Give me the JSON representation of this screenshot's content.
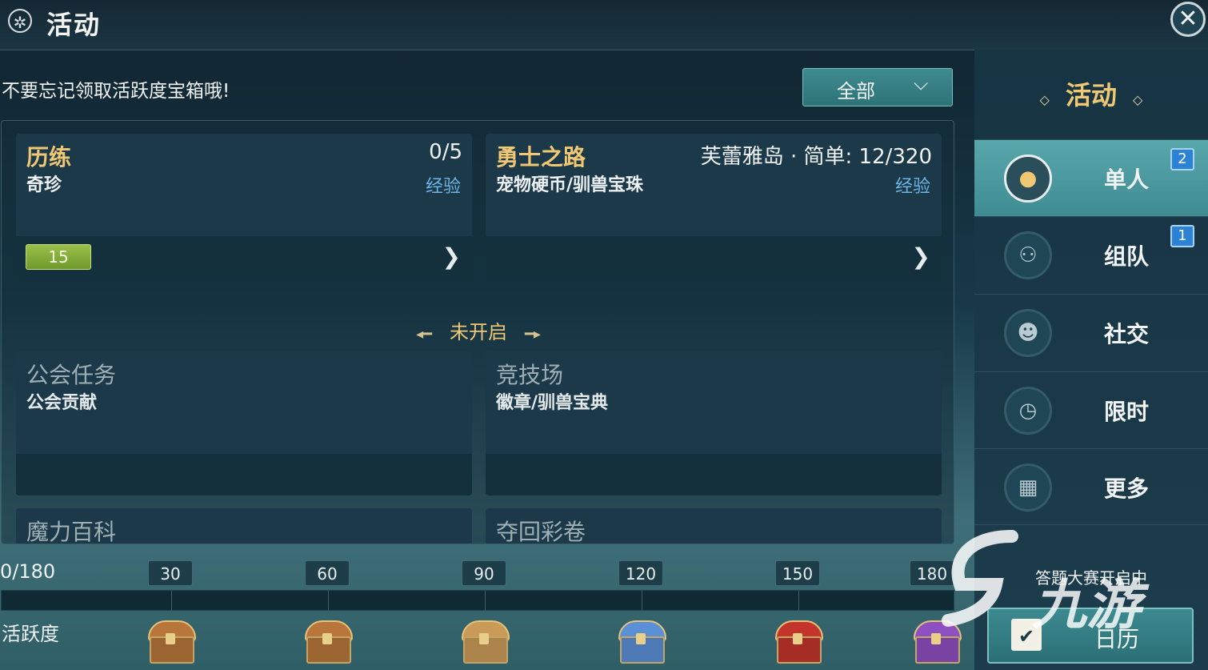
{
  "header": {
    "title": "活动",
    "title_icon": "wheel-icon",
    "close_icon": "close-icon"
  },
  "reminder": "不要忘记领取活跃度宝箱哦!",
  "filter": {
    "selected": "全部",
    "chevron": "⌄"
  },
  "cards": [
    {
      "title": "历练",
      "subtitle": "奇珍",
      "count": "0/5",
      "reward": "经验",
      "level": "15",
      "arrow": "›"
    },
    {
      "title": "勇士之路",
      "subtitle": "宠物硬币/驯兽宝珠",
      "count": "芙蕾雅岛 · 简单: 12/320",
      "reward": "经验",
      "arrow": "›"
    }
  ],
  "not_open_label": "未开启",
  "locked_cards": [
    {
      "title": "公会任务",
      "subtitle": "公会贡献"
    },
    {
      "title": "竞技场",
      "subtitle": "徽章/驯兽宝典"
    },
    {
      "title": "魔力百科"
    },
    {
      "title": "夺回彩卷"
    }
  ],
  "activity": {
    "progress_text": "0/180",
    "current": 0,
    "max": 180,
    "label": "活跃度",
    "milestones": [
      "30",
      "60",
      "90",
      "120",
      "150",
      "180"
    ],
    "chests": [
      {
        "name": "wooden-chest",
        "color": "#b8763a"
      },
      {
        "name": "wooden-chest",
        "color": "#b8763a"
      },
      {
        "name": "bronze-chest",
        "color": "#c99a58"
      },
      {
        "name": "silver-blue-chest",
        "color": "#5b8fd6"
      },
      {
        "name": "red-gold-chest",
        "color": "#c3352b"
      },
      {
        "name": "purple-gold-chest",
        "color": "#8e4fc0"
      }
    ]
  },
  "sidebar": {
    "heading": "活动",
    "items": [
      {
        "label": "单人",
        "icon": "person-icon",
        "badge": "2",
        "active": true
      },
      {
        "label": "组队",
        "icon": "group-icon",
        "badge": "1",
        "active": false
      },
      {
        "label": "社交",
        "icon": "social-icon",
        "badge": "",
        "active": false
      },
      {
        "label": "限时",
        "icon": "clock-icon",
        "badge": "",
        "active": false
      },
      {
        "label": "更多",
        "icon": "grid-icon",
        "badge": "",
        "active": false
      }
    ],
    "announcement": "答题大赛开启中",
    "calendar_label": "日历"
  },
  "watermark": {
    "text": "九游"
  },
  "colors": {
    "accent_gold": "#f0c873",
    "exp_blue": "#6fb4e6",
    "badge_blue": "#2c83d6",
    "active_tab": "#4f9ea3"
  }
}
